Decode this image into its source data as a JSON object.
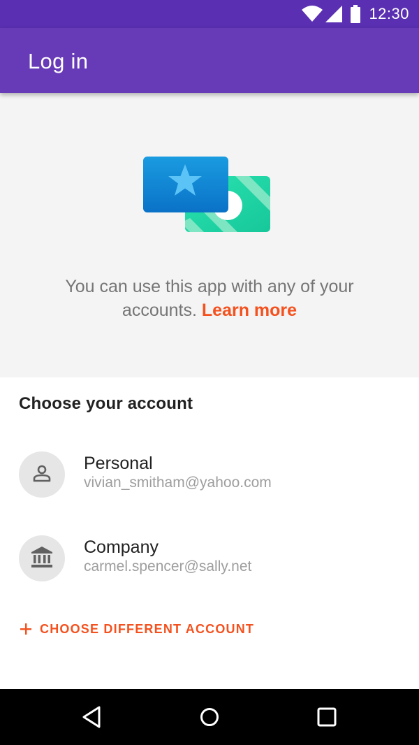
{
  "status_bar": {
    "time": "12:30",
    "icons": [
      "wifi-icon",
      "cellular-signal-icon",
      "battery-icon"
    ]
  },
  "app_bar": {
    "title": "Log in"
  },
  "hero": {
    "illustration": "cards-money-illustration",
    "text": "You can use this app with any of your accounts.",
    "learn_more": "Learn more"
  },
  "accounts": {
    "section_title": "Choose your account",
    "items": [
      {
        "name": "Personal",
        "email": "vivian_smitham@yahoo.com",
        "icon": "person-icon"
      },
      {
        "name": "Company",
        "email": "carmel.spencer@sally.net",
        "icon": "bank-icon"
      }
    ],
    "choose_different": "CHOOSE DIFFERENT ACCOUNT"
  },
  "navigation": {
    "icons": [
      "back-icon",
      "home-icon",
      "recent-apps-icon"
    ]
  },
  "colors": {
    "status_bar": "#5a2fb1",
    "app_bar": "#673ab7",
    "accent": "#f4511e",
    "hero_background": "#f4f4f4"
  }
}
